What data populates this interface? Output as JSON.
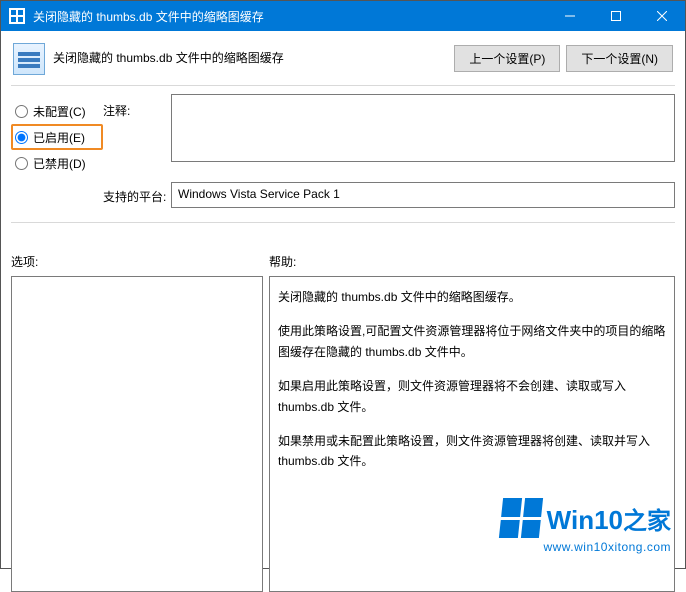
{
  "window": {
    "title": "关闭隐藏的 thumbs.db 文件中的缩略图缓存"
  },
  "header": {
    "title": "关闭隐藏的 thumbs.db 文件中的缩略图缓存",
    "prev_btn": "上一个设置(P)",
    "next_btn": "下一个设置(N)"
  },
  "radios": {
    "not_configured": "未配置(C)",
    "enabled": "已启用(E)",
    "disabled": "已禁用(D)"
  },
  "labels": {
    "comment": "注释:",
    "platform": "支持的平台:",
    "options": "选项:",
    "help": "帮助:"
  },
  "fields": {
    "comment_value": "",
    "platform_value": "Windows Vista Service Pack 1"
  },
  "help": {
    "p1": "关闭隐藏的 thumbs.db 文件中的缩略图缓存。",
    "p2": "使用此策略设置,可配置文件资源管理器将位于网络文件夹中的项目的缩略图缓存在隐藏的 thumbs.db 文件中。",
    "p3": "如果启用此策略设置，则文件资源管理器将不会创建、读取或写入 thumbs.db 文件。",
    "p4": "如果禁用或未配置此策略设置，则文件资源管理器将创建、读取并写入 thumbs.db 文件。"
  },
  "watermark": {
    "brand_en": "Win10",
    "brand_zh": "之家",
    "url": "www.win10xitong.com"
  }
}
